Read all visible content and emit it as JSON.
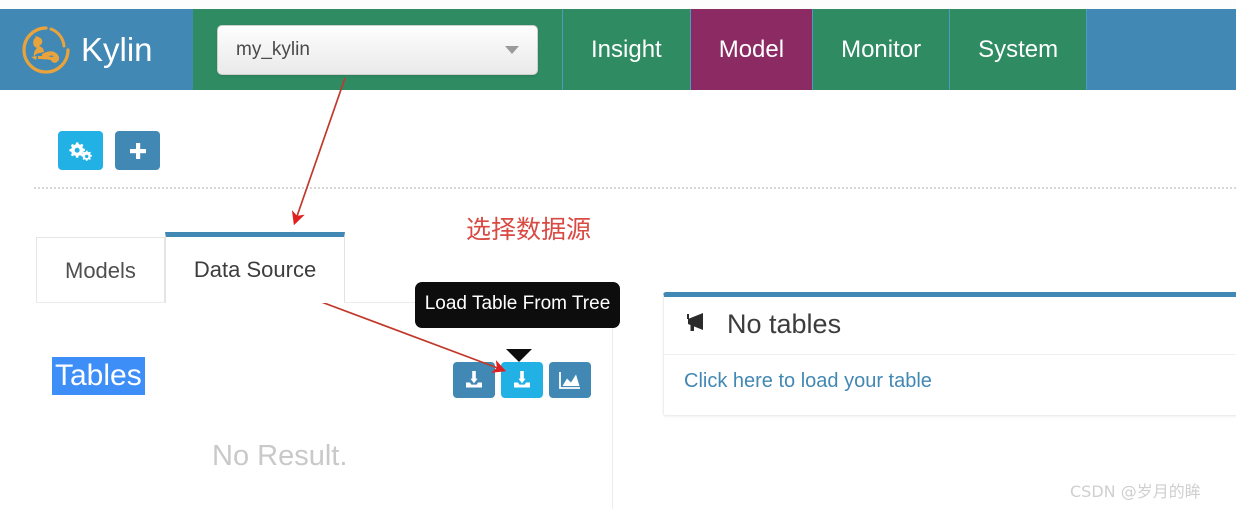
{
  "app": {
    "brand_name": "Kylin",
    "logo_icon": "kylin-creature-logo"
  },
  "header": {
    "project_selector": {
      "value": "my_kylin",
      "caret_icon": "chevron-down-icon"
    },
    "nav_items": [
      {
        "label": "Insight",
        "active": false
      },
      {
        "label": "Model",
        "active": true
      },
      {
        "label": "Monitor",
        "active": false
      },
      {
        "label": "System",
        "active": false
      }
    ],
    "colors": {
      "brand_bg": "#4288b4",
      "nav_bg": "#2e8b62",
      "nav_active_bg": "#8b2a63"
    }
  },
  "toolbar": {
    "buttons": [
      {
        "name": "settings-gears-button",
        "icon": "gears-icon",
        "color": "#22b1e5"
      },
      {
        "name": "add-button",
        "icon": "plus-icon",
        "color": "#4288b4"
      }
    ]
  },
  "tabs": [
    {
      "label": "Models",
      "active": false
    },
    {
      "label": "Data Source",
      "active": true
    }
  ],
  "left_pane": {
    "tables_label": "Tables",
    "tables_label_selected": true,
    "no_result_text": "No Result.",
    "selection_color": "#3e8ef7"
  },
  "action_buttons": [
    {
      "name": "load-table-button",
      "icon": "download-table-icon",
      "highlighted": false
    },
    {
      "name": "load-table-from-tree-button",
      "icon": "download-table-icon",
      "highlighted": true
    },
    {
      "name": "load-table-image-button",
      "icon": "image-chart-icon",
      "highlighted": false
    }
  ],
  "tooltip": {
    "text": "Load Table From Tree",
    "target": "load-table-from-tree-button"
  },
  "right_panel": {
    "icon": "megaphone-icon",
    "title": "No tables",
    "link_text": "Click here to load your table",
    "accent_color": "#4288b4"
  },
  "annotations": {
    "note_text": "选择数据源",
    "note_color": "#d94a43",
    "arrows": [
      {
        "name": "arrow-to-data-source-tab",
        "from": "project-selector",
        "to": "tab-data-source"
      },
      {
        "name": "arrow-to-load-table-button",
        "from": "tab-data-source",
        "to": "load-table-from-tree-button"
      }
    ]
  },
  "watermark": {
    "text": "CSDN @岁月的眸"
  }
}
